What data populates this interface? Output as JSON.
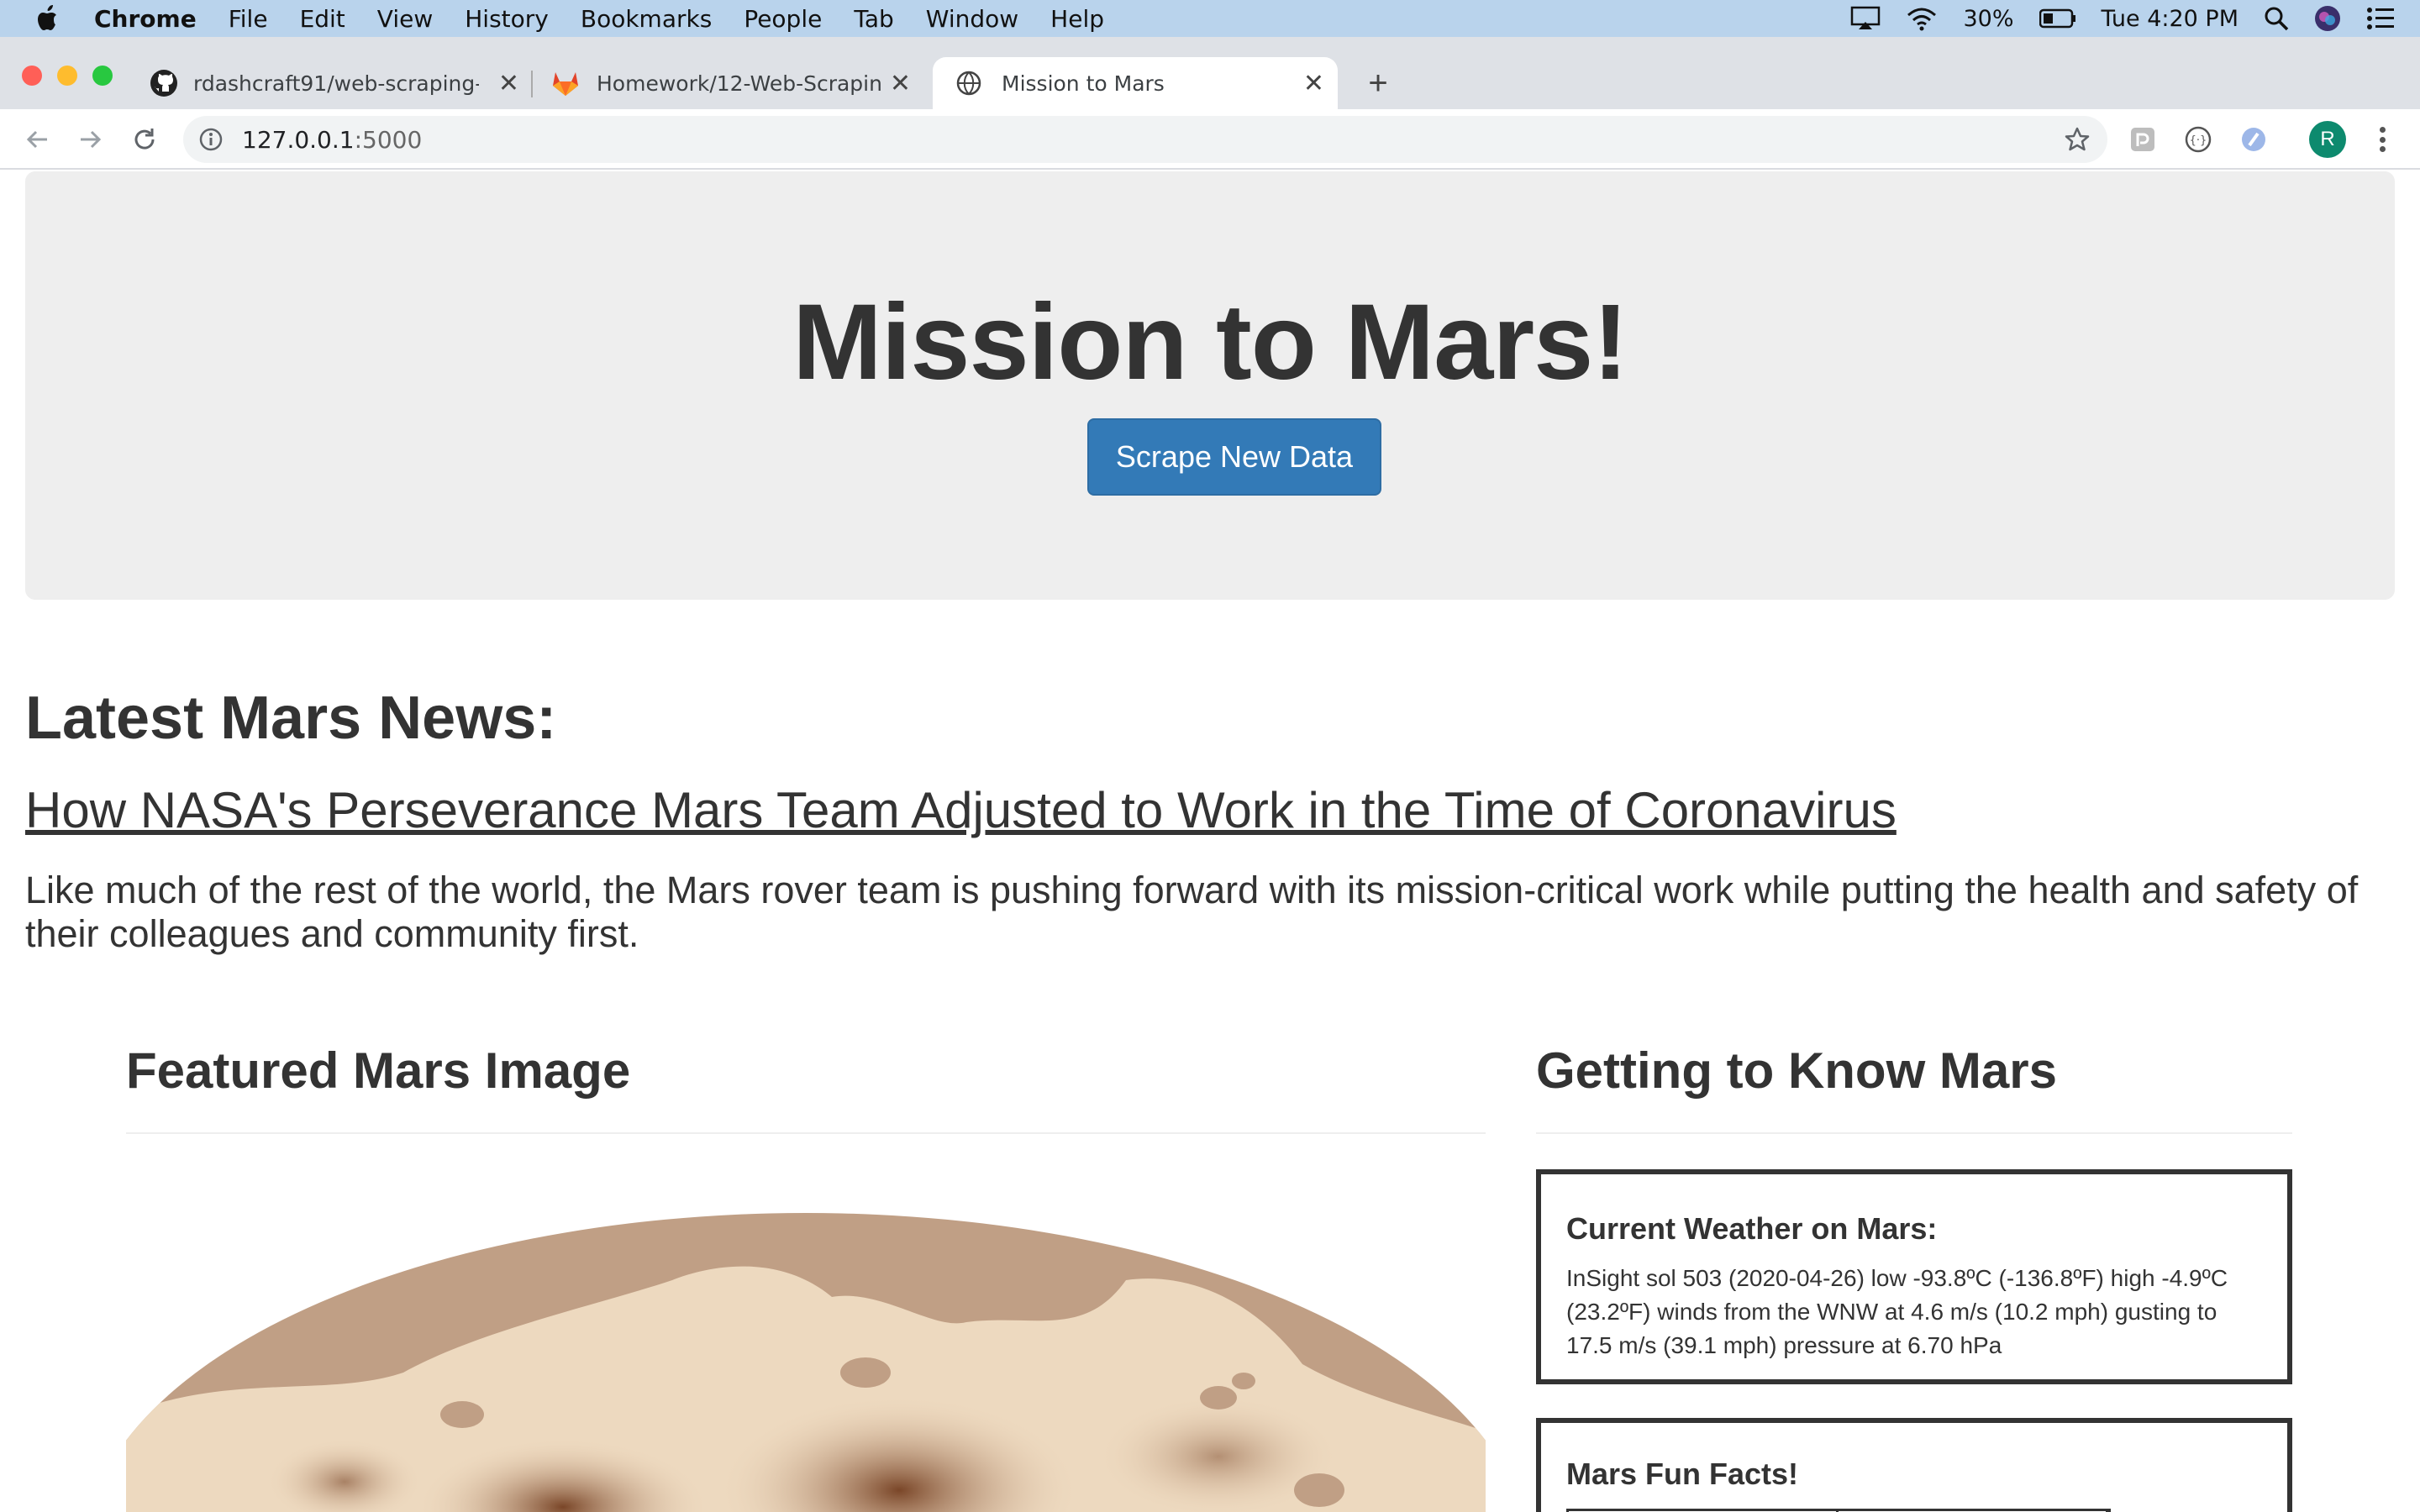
{
  "menubar": {
    "app_name": "Chrome",
    "items": [
      "File",
      "Edit",
      "View",
      "History",
      "Bookmarks",
      "People",
      "Tab",
      "Window",
      "Help"
    ],
    "battery": "30%",
    "clock": "Tue 4:20 PM"
  },
  "tabs": [
    {
      "title": "rdashcraft91/web-scraping-ch",
      "icon": "github-icon",
      "active": false
    },
    {
      "title": "Homework/12-Web-Scraping-a",
      "icon": "gitlab-icon",
      "active": false
    },
    {
      "title": "Mission to Mars",
      "icon": "globe-icon",
      "active": true
    }
  ],
  "toolbar": {
    "url_host": "127.0.0.1",
    "url_port": ":5000",
    "profile_initial": "R"
  },
  "page": {
    "title": "Mission to Mars!",
    "scrape_button": "Scrape New Data",
    "news_heading": "Latest Mars News:",
    "news_title": "How NASA's Perseverance Mars Team Adjusted to Work in the Time of Coronavirus",
    "news_paragraph": "Like much of the rest of the world, the Mars rover team is pushing forward with its mission-critical work while putting the health and safety of their colleagues and community first.",
    "featured_heading": "Featured Mars Image",
    "know_heading": "Getting to Know Mars",
    "weather_heading": "Current Weather on Mars:",
    "weather_text": "InSight sol 503 (2020-04-26) low -93.8ºC (-136.8ºF) high -4.9ºC (23.2ºF) winds from the WNW at 4.6 m/s (10.2 mph) gusting to 17.5 m/s (39.1 mph) pressure at 6.70 hPa",
    "facts_heading": "Mars Fun Facts!"
  },
  "colors": {
    "menubar_bg": "#b9d3ec",
    "tabstrip_bg": "#dee1e6",
    "jumbotron_bg": "#eeeeee",
    "button_blue": "#337ab7",
    "mars_surface": "#c09f85",
    "avatar_green": "#0d8a6e"
  }
}
